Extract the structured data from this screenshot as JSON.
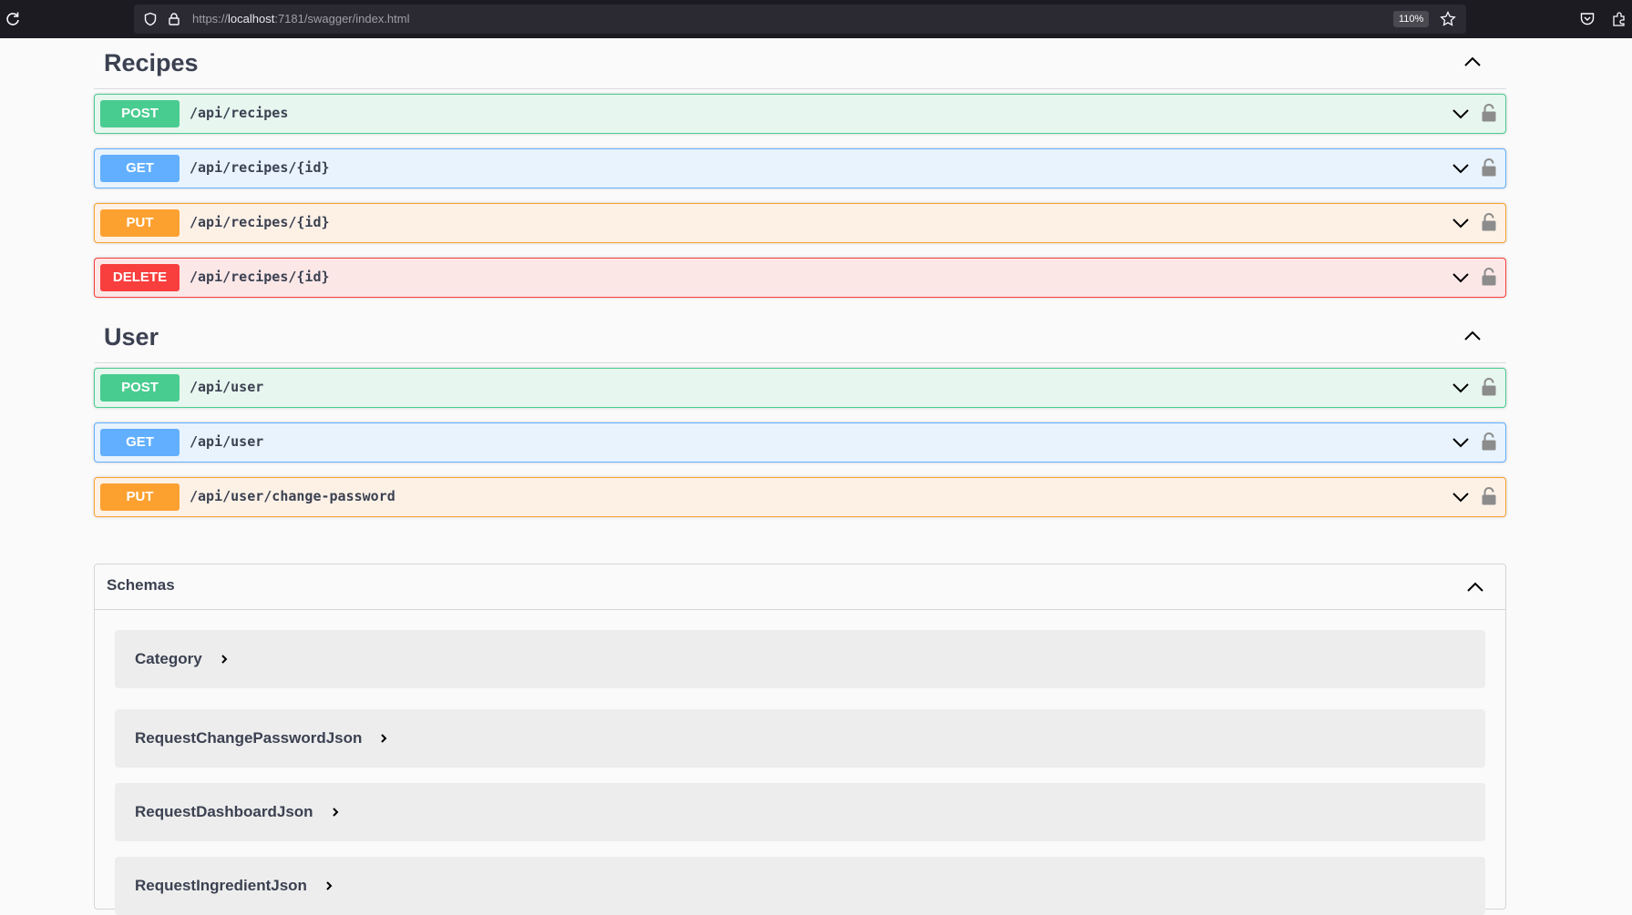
{
  "browser": {
    "url_prefix": "https://",
    "url_host": "localhost",
    "url_rest": ":7181/swagger/index.html",
    "zoom": "110%"
  },
  "tags": [
    {
      "name": "Recipes",
      "operations": [
        {
          "method": "POST",
          "path": "/api/recipes"
        },
        {
          "method": "GET",
          "path": "/api/recipes/{id}"
        },
        {
          "method": "PUT",
          "path": "/api/recipes/{id}"
        },
        {
          "method": "DELETE",
          "path": "/api/recipes/{id}"
        }
      ]
    },
    {
      "name": "User",
      "operations": [
        {
          "method": "POST",
          "path": "/api/user"
        },
        {
          "method": "GET",
          "path": "/api/user"
        },
        {
          "method": "PUT",
          "path": "/api/user/change-password"
        }
      ]
    }
  ],
  "schemas": {
    "title": "Schemas",
    "models": [
      "Category",
      "RequestChangePasswordJson",
      "RequestDashboardJson",
      "RequestIngredientJson"
    ]
  },
  "colors": {
    "post": "#49cc90",
    "get": "#61affe",
    "put": "#fca130",
    "delete": "#f93e3e",
    "text": "#3b4151"
  }
}
